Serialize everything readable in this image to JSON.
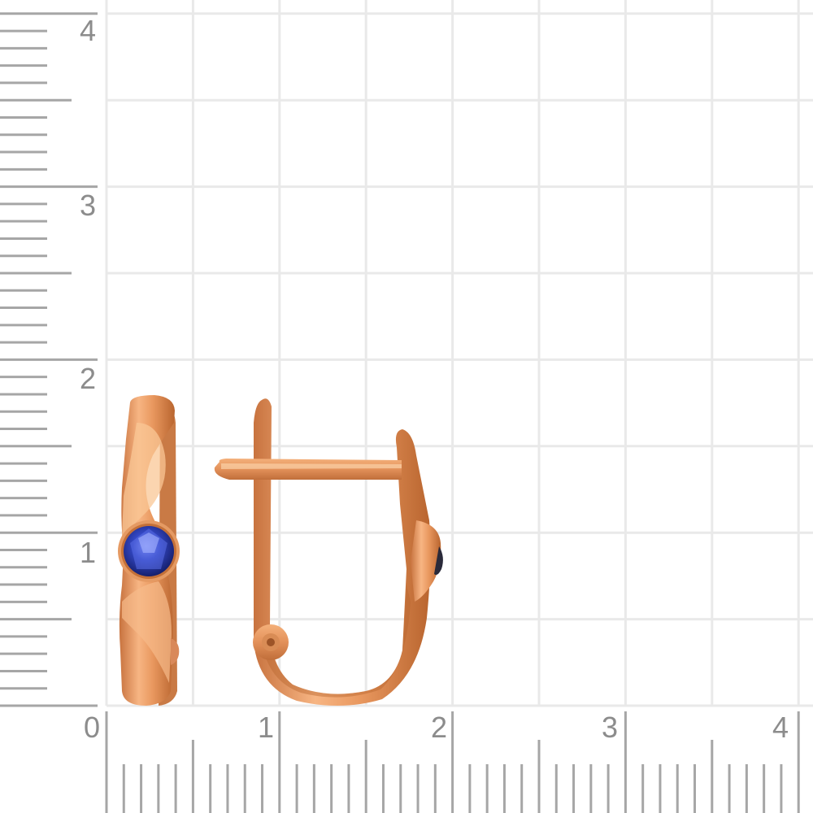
{
  "image": {
    "description_free": true
  },
  "ruler": {
    "vertical_labels": [
      "4",
      "3",
      "2",
      "1"
    ],
    "horizontal_labels": [
      "0",
      "1",
      "2",
      "3",
      "4"
    ],
    "tick_color": "#a6a6a6",
    "grid_color": "#e9e9e9",
    "label_color": "#8c8c8c"
  },
  "earrings": {
    "metal_color": "#e8a070",
    "metal_highlight": "#fbd0a8",
    "metal_shadow": "#c0703e",
    "stone_color": "#2c3fb0",
    "stone_highlight": "#8fa0ff"
  }
}
